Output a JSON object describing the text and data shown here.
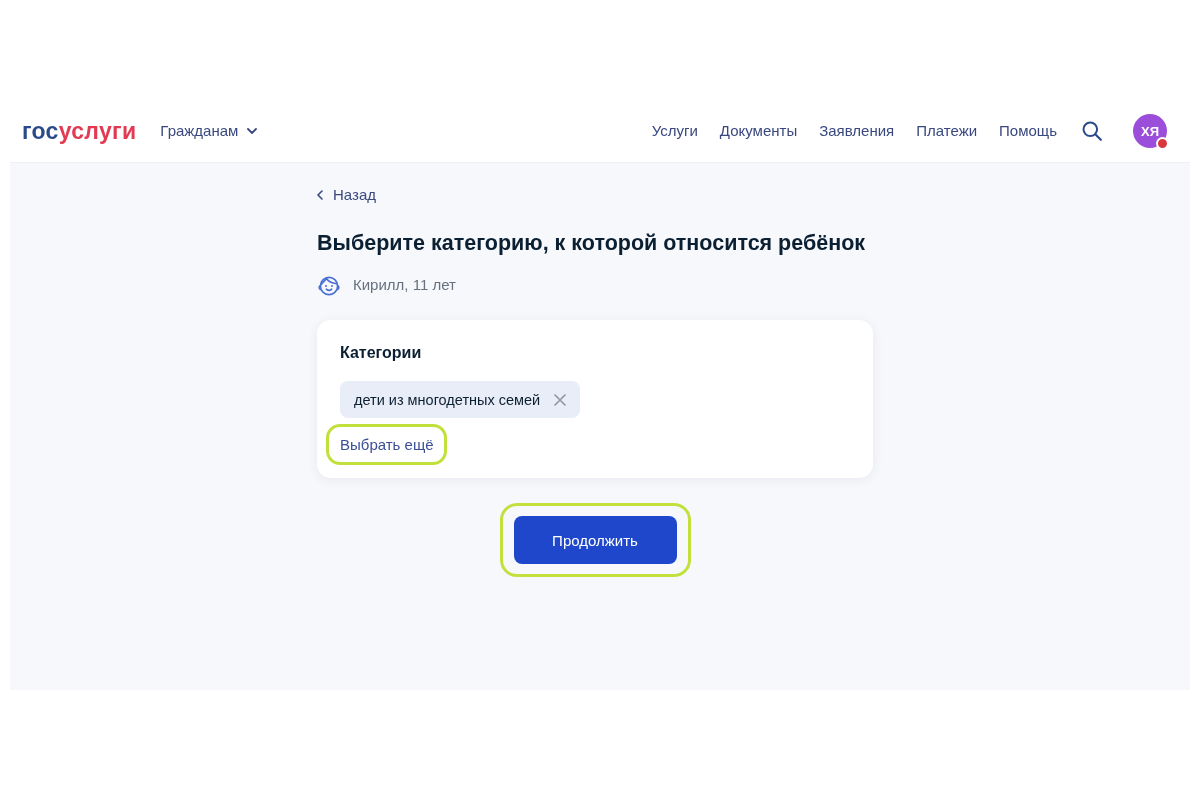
{
  "header": {
    "logo": {
      "primary": "гос",
      "accent": "услуги"
    },
    "audience_menu": {
      "label": "Гражданам"
    },
    "nav": [
      "Услуги",
      "Документы",
      "Заявления",
      "Платежи",
      "Помощь"
    ],
    "avatar": {
      "initials": "ХЯ",
      "notification": true
    }
  },
  "back_link": {
    "label": "Назад"
  },
  "title": "Выберите категорию, к которой относится ребёнок",
  "child": {
    "label": "Кирилл, 11 лет"
  },
  "card": {
    "title": "Категории",
    "chips": [
      {
        "label": "дети из многодетных семей"
      }
    ],
    "add_link": {
      "label": "Выбрать ещё",
      "highlighted": true
    }
  },
  "primary_button": {
    "label": "Продолжить",
    "highlighted": true
  }
}
